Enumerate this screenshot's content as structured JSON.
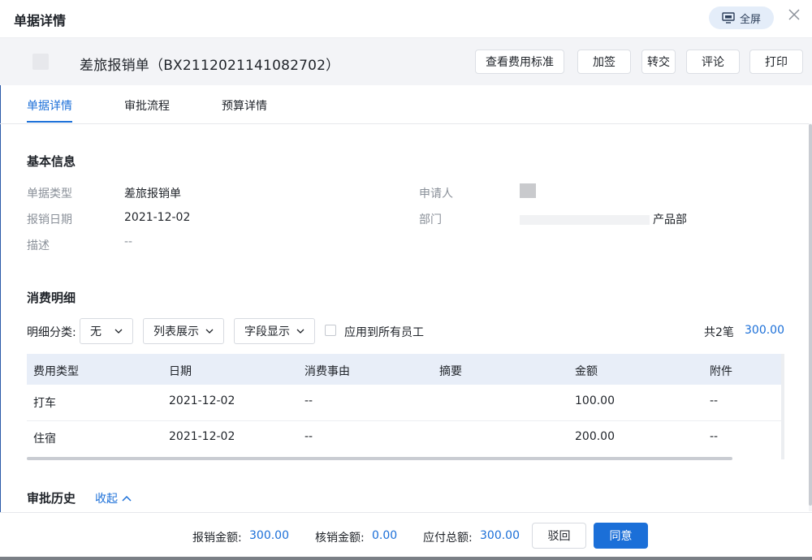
{
  "window": {
    "title": "单据详情",
    "fullscreen_label": "全屏",
    "close_icon": "close-icon",
    "fullscreen_icon": "monitor-icon"
  },
  "document": {
    "title": "差旅报销单（BX2112021141082702）",
    "actions": [
      "查看费用标准",
      "加签",
      "转交",
      "评论",
      "打印"
    ]
  },
  "tabs": [
    "单据详情",
    "审批流程",
    "预算详情"
  ],
  "basic_info": {
    "section_title": "基本信息",
    "doc_type_label": "单据类型",
    "doc_type_value": "差旅报销单",
    "date_label": "报销日期",
    "date_value": "2021-12-02",
    "desc_label": "描述",
    "desc_value": "--",
    "applicant_label": "申请人",
    "dept_label": "部门",
    "dept_value": "产品部"
  },
  "expense": {
    "section_title": "消费明细",
    "filter_label": "明细分类:",
    "category_select": "无",
    "view_select": "列表展示",
    "field_select": "字段显示",
    "apply_all_label": "应用到所有员工",
    "count_text": "共2笔",
    "total": "300.00",
    "columns": [
      "费用类型",
      "日期",
      "消费事由",
      "摘要",
      "金额",
      "附件"
    ],
    "rows": [
      [
        "打车",
        "2021-12-02",
        "--",
        "",
        "100.00",
        "--"
      ],
      [
        "住宿",
        "2021-12-02",
        "--",
        "",
        "200.00",
        "--"
      ]
    ]
  },
  "history": {
    "section_title": "审批历史",
    "collapse_label": "收起"
  },
  "footer": {
    "reimburse_label": "报销金额:",
    "reimburse_value": "300.00",
    "writeoff_label": "核销金额:",
    "writeoff_value": "0.00",
    "payable_label": "应付总额:",
    "payable_value": "300.00",
    "reject_label": "驳回",
    "agree_label": "同意"
  },
  "colors": {
    "accent": "#1b6fd8",
    "table_header": "#e8eef8",
    "header_band": "#f3f4f7"
  }
}
